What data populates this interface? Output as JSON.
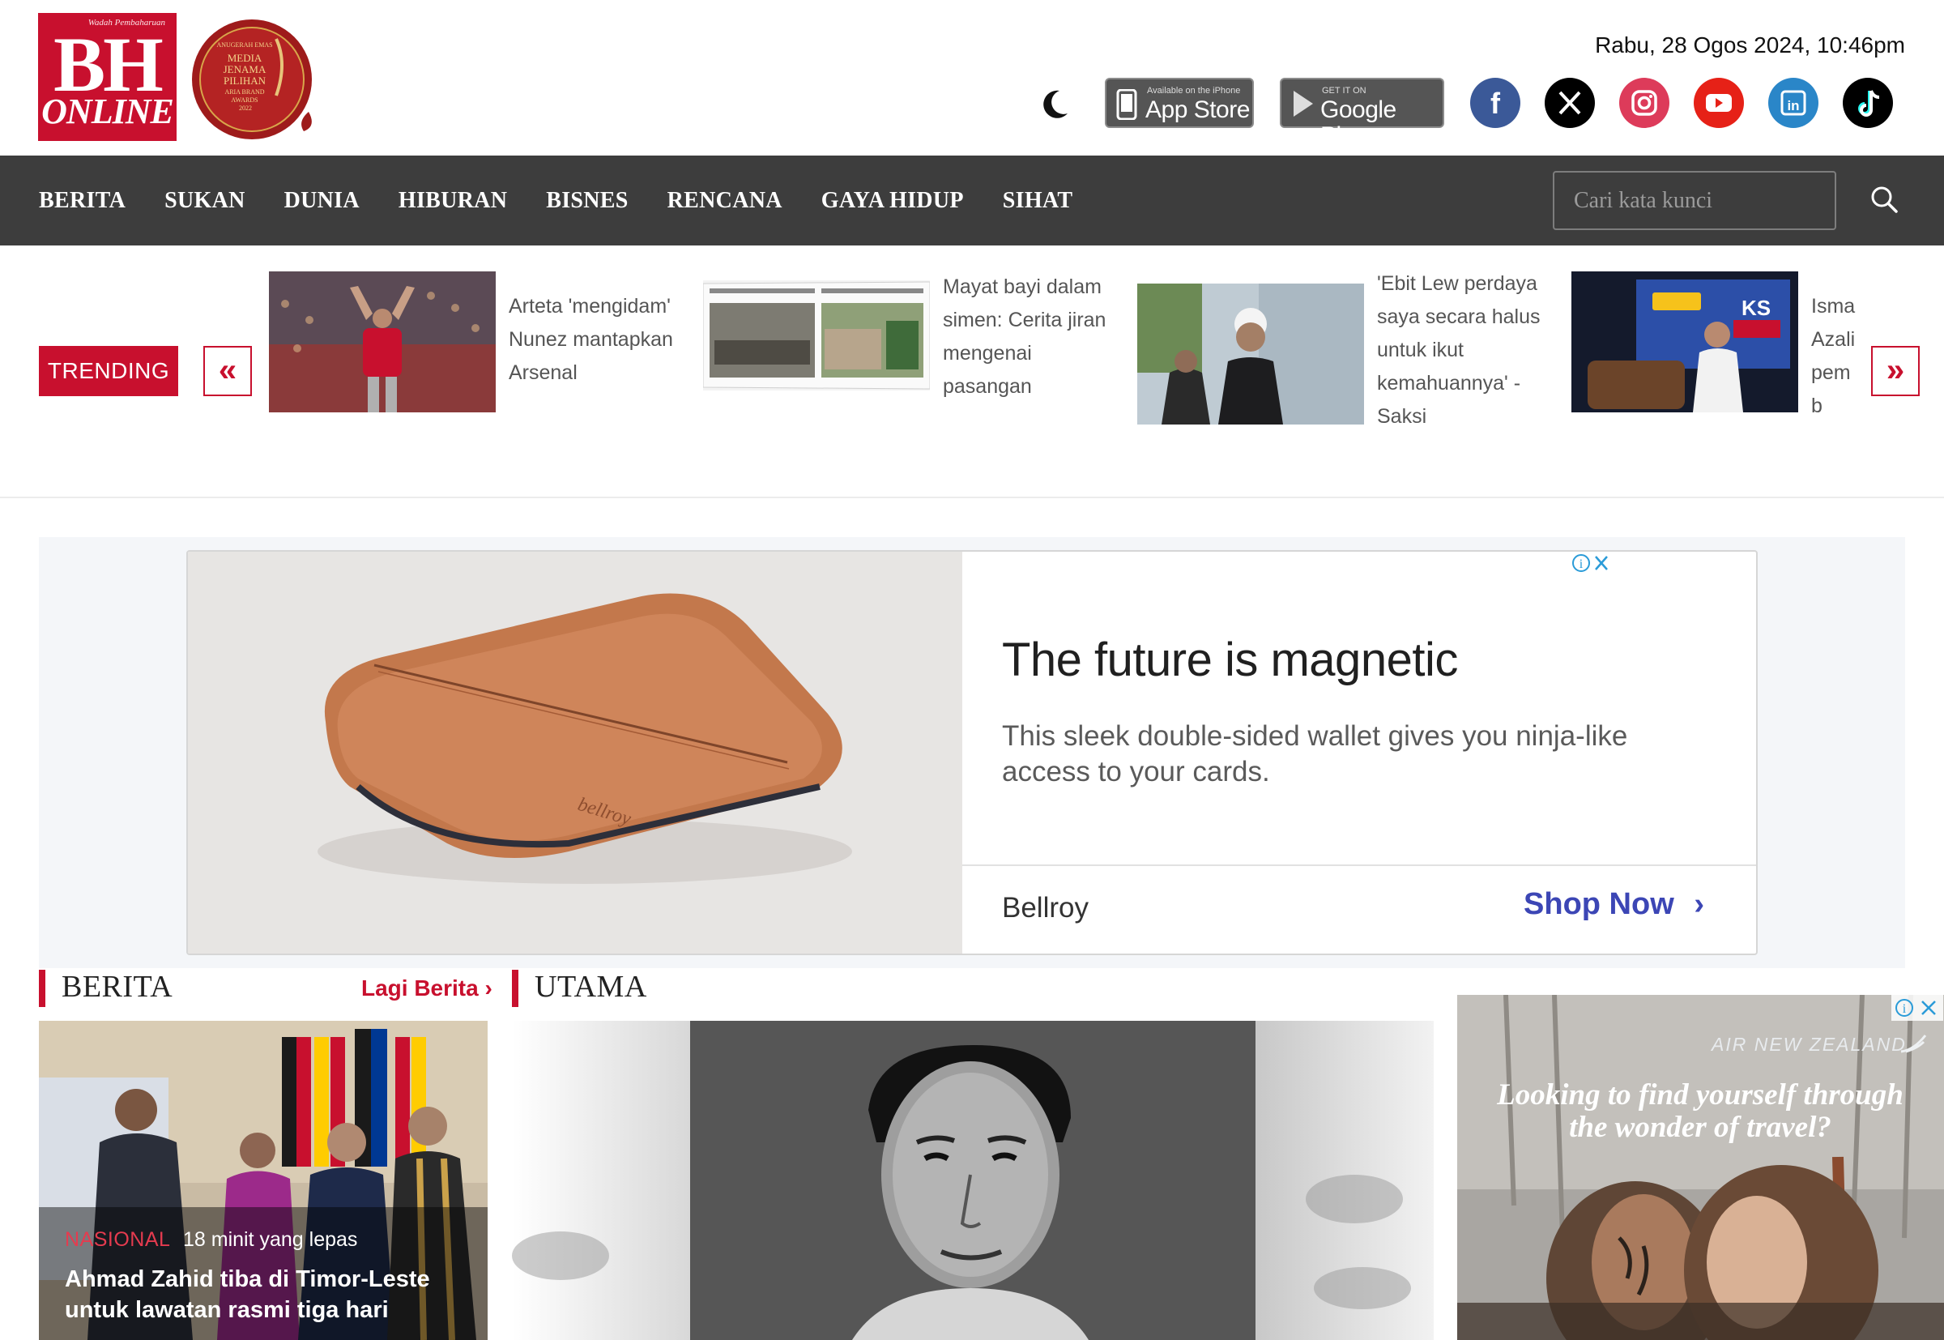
{
  "header": {
    "logo_tagline": "Wadah Pembaharuan",
    "logo_main": "BH",
    "logo_sub": "ONLINE",
    "award_lines": [
      "ANUGERAH EMAS",
      "MEDIA",
      "JENAMA",
      "PILIHAN",
      "ARIA BRAND",
      "AWARDS",
      "2022"
    ],
    "date_time": "Rabu, 28 Ogos 2024, 10:46pm",
    "appstore_small": "Available on the iPhone",
    "appstore_big": "App Store",
    "gplay_small": "GET IT ON",
    "gplay_big": "Google Play",
    "social_icons": [
      "facebook-icon",
      "x-icon",
      "instagram-icon",
      "youtube-icon",
      "linkedin-icon",
      "tiktok-icon"
    ]
  },
  "nav": {
    "items": [
      "BERITA",
      "SUKAN",
      "DUNIA",
      "HIBURAN",
      "BISNES",
      "RENCANA",
      "GAYA HIDUP",
      "SIHAT"
    ],
    "search_placeholder": "Cari kata kunci"
  },
  "trending": {
    "label": "TRENDING",
    "prev": "«",
    "next": "»",
    "items": [
      {
        "title": "Arteta 'mengidam' Nunez mantapkan Arsenal"
      },
      {
        "title": "Mayat bayi dalam simen: Cerita jiran mengenai pasangan"
      },
      {
        "title": "'Ebit Lew perdaya saya secara halus untuk ikut kemahuannya' - Saksi"
      },
      {
        "title": "Isma Azali pemb"
      }
    ]
  },
  "ad": {
    "headline": "The future is magnetic",
    "description": "This sleek double-sided wallet gives you ninja-like access to your cards.",
    "brand": "Bellroy",
    "cta": "Shop Now",
    "product_mark": "bellroy"
  },
  "berita": {
    "title": "BERITA",
    "more": "Lagi Berita ›",
    "card": {
      "category": "NASIONAL",
      "time": "18 minit yang lepas",
      "title": "Ahmad Zahid tiba di Timor-Leste untuk lawatan rasmi tiga hari"
    }
  },
  "utama": {
    "title": "UTAMA"
  },
  "side_ad": {
    "brand": "AIR NEW ZEALAND",
    "headline": "Looking to find yourself through the wonder of travel?"
  },
  "colors": {
    "brand_red": "#c8102e",
    "nav_bg": "#3d3d3d",
    "ad_cta": "#3c46b5"
  }
}
